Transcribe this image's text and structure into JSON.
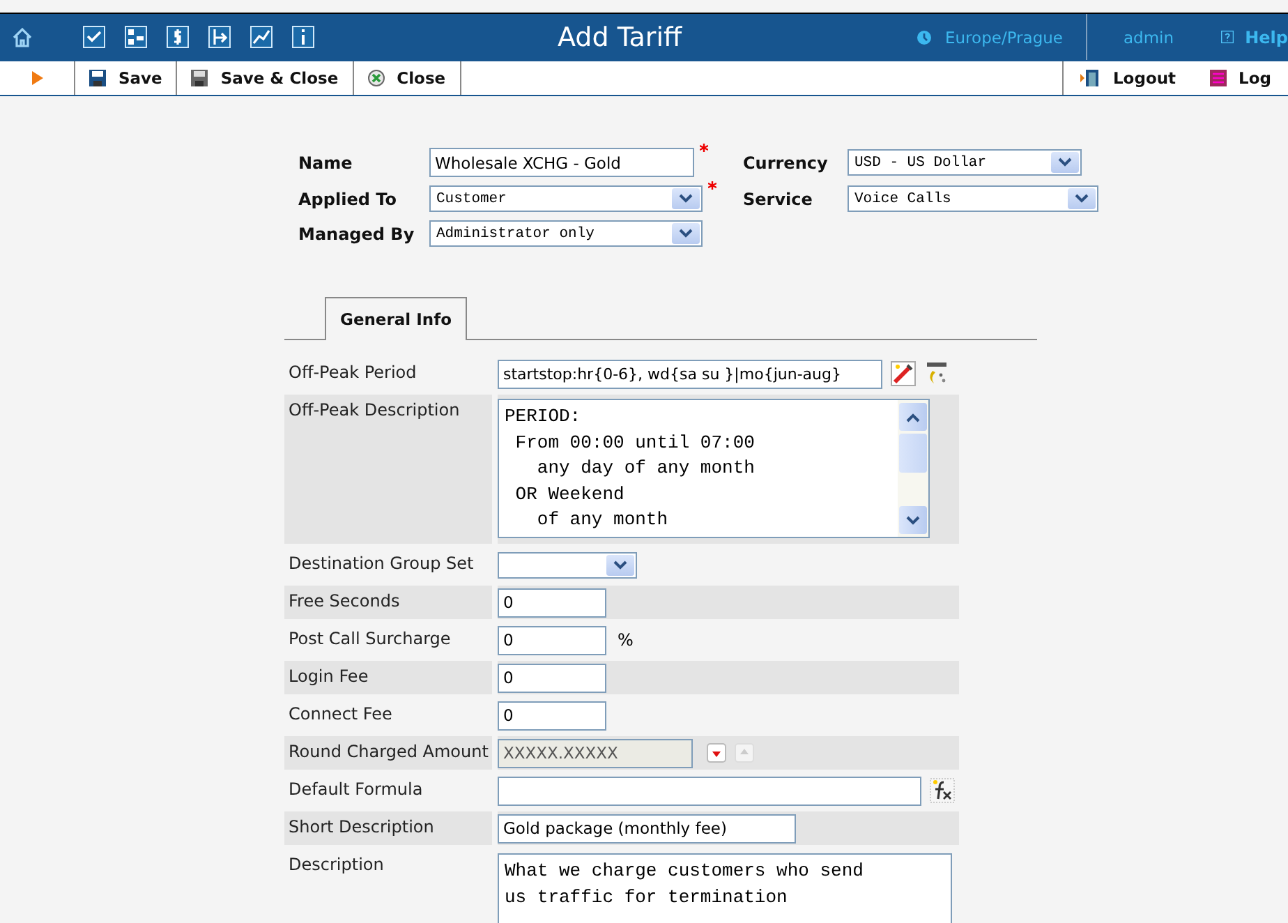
{
  "header": {
    "title": "Add Tariff",
    "timezone": "Europe/Prague",
    "user": "admin",
    "help": "Help"
  },
  "toolbar": {
    "left": [
      {
        "kind": "save",
        "label": "Save"
      },
      {
        "kind": "save-close",
        "label": "Save & Close"
      },
      {
        "kind": "close",
        "label": "Close"
      }
    ],
    "right": [
      {
        "kind": "logout",
        "label": "Logout"
      },
      {
        "kind": "log",
        "label": "Log"
      }
    ]
  },
  "top_fields": [
    {
      "label": "Name",
      "kind": "text",
      "value": "Wholesale XCHG - Gold",
      "required": true
    },
    {
      "label": "Currency",
      "kind": "select",
      "value": "USD - US Dollar",
      "required": false
    },
    {
      "label": "Applied To",
      "kind": "select",
      "value": "Customer",
      "required": true
    },
    {
      "label": "Service",
      "kind": "select",
      "value": "Voice Calls",
      "required": false
    },
    {
      "label": "Managed By",
      "kind": "select",
      "value": "Administrator only",
      "required": false
    }
  ],
  "tabs": [
    {
      "label": "General Info",
      "selected": true
    }
  ],
  "rows": [
    {
      "label": "Off-Peak Period",
      "kind": "period",
      "value": "startstop:hr{0-6}, wd{sa su }|mo{jun-aug}"
    },
    {
      "label": "Off-Peak Description",
      "kind": "textarea",
      "lines": [
        "PERIOD:",
        " From 00:00 until 07:00",
        "   any day of any month",
        " OR Weekend",
        "   of any month"
      ]
    },
    {
      "label": "Destination Group Set",
      "kind": "select"
    },
    {
      "label": "Free Seconds",
      "kind": "text",
      "value": "0"
    },
    {
      "label": "Post Call Surcharge",
      "kind": "text",
      "value": "0",
      "suffix": "%"
    },
    {
      "label": "Login Fee",
      "kind": "text",
      "value": "0"
    },
    {
      "label": "Connect Fee",
      "kind": "text",
      "value": "0"
    },
    {
      "label": "Round Charged Amount",
      "kind": "readonly",
      "value": "XXXXX.XXXXX"
    },
    {
      "label": "Default Formula",
      "kind": "formula",
      "value": ""
    },
    {
      "label": "Short Description",
      "kind": "wide",
      "value": "Gold package (monthly fee)"
    },
    {
      "label": "Description",
      "kind": "memo",
      "lines": [
        "What we charge customers who send",
        "us traffic for termination"
      ]
    }
  ]
}
